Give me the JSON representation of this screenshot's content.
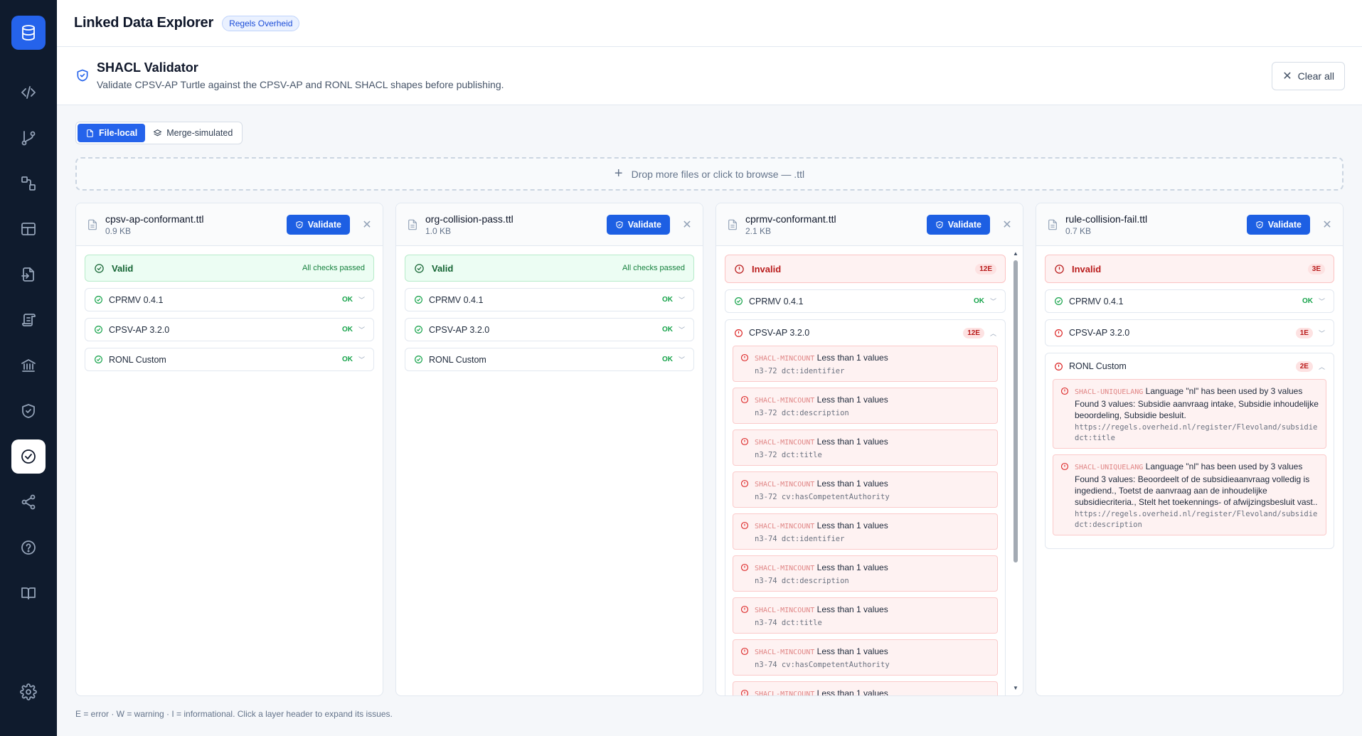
{
  "app": {
    "title": "Linked Data Explorer",
    "badge": "Regels Overheid"
  },
  "sidebar": {
    "items": [
      {
        "name": "database-icon"
      },
      {
        "name": "code-icon"
      },
      {
        "name": "git-branch-icon"
      },
      {
        "name": "shapes-icon"
      },
      {
        "name": "layout-icon"
      },
      {
        "name": "file-import-icon"
      },
      {
        "name": "scroll-icon"
      },
      {
        "name": "institution-icon"
      },
      {
        "name": "shield-check-icon"
      },
      {
        "name": "circle-check-icon",
        "active": true
      },
      {
        "name": "share-icon"
      },
      {
        "name": "help-circle-icon"
      },
      {
        "name": "book-icon"
      },
      {
        "name": "gear-icon"
      }
    ]
  },
  "page": {
    "title": "SHACL Validator",
    "description": "Validate CPSV-AP Turtle against the CPSV-AP and RONL SHACL shapes before publishing.",
    "clear_label": "Clear all"
  },
  "mode": {
    "options": [
      "File-local",
      "Merge-simulated"
    ],
    "selected": "File-local"
  },
  "dropzone": {
    "label": "Drop more files or click to browse — .ttl"
  },
  "validate_label": "Validate",
  "ok_label": "OK",
  "files": [
    {
      "name": "cpsv-ap-conformant.ttl",
      "size": "0.9 KB",
      "status": "Valid",
      "status_note": "All checks passed",
      "layers": [
        {
          "name": "CPRMV 0.4.1",
          "result": "OK"
        },
        {
          "name": "CPSV-AP 3.2.0",
          "result": "OK"
        },
        {
          "name": "RONL Custom",
          "result": "OK"
        }
      ]
    },
    {
      "name": "org-collision-pass.ttl",
      "size": "1.0 KB",
      "status": "Valid",
      "status_note": "All checks passed",
      "layers": [
        {
          "name": "CPRMV 0.4.1",
          "result": "OK"
        },
        {
          "name": "CPSV-AP 3.2.0",
          "result": "OK"
        },
        {
          "name": "RONL Custom",
          "result": "OK"
        }
      ]
    },
    {
      "name": "cprmv-conformant.ttl",
      "size": "2.1 KB",
      "status": "Invalid",
      "status_count": "12E",
      "layers": [
        {
          "name": "CPRMV 0.4.1",
          "result": "OK"
        },
        {
          "name": "CPSV-AP 3.2.0",
          "result": "12E",
          "expanded": true,
          "issues": [
            {
              "code": "SHACL-MINCOUNT",
              "message": "Less than 1 values",
              "path": "n3-72 dct:identifier"
            },
            {
              "code": "SHACL-MINCOUNT",
              "message": "Less than 1 values",
              "path": "n3-72 dct:description"
            },
            {
              "code": "SHACL-MINCOUNT",
              "message": "Less than 1 values",
              "path": "n3-72 dct:title"
            },
            {
              "code": "SHACL-MINCOUNT",
              "message": "Less than 1 values",
              "path": "n3-72 cv:hasCompetentAuthority"
            },
            {
              "code": "SHACL-MINCOUNT",
              "message": "Less than 1 values",
              "path": "n3-74 dct:identifier"
            },
            {
              "code": "SHACL-MINCOUNT",
              "message": "Less than 1 values",
              "path": "n3-74 dct:description"
            },
            {
              "code": "SHACL-MINCOUNT",
              "message": "Less than 1 values",
              "path": "n3-74 dct:title"
            },
            {
              "code": "SHACL-MINCOUNT",
              "message": "Less than 1 values",
              "path": "n3-74 cv:hasCompetentAuthority"
            },
            {
              "code": "SHACL-MINCOUNT",
              "message": "Less than 1 values",
              "path": ""
            }
          ]
        }
      ]
    },
    {
      "name": "rule-collision-fail.ttl",
      "size": "0.7 KB",
      "status": "Invalid",
      "status_count": "3E",
      "layers": [
        {
          "name": "CPRMV 0.4.1",
          "result": "OK"
        },
        {
          "name": "CPSV-AP 3.2.0",
          "result": "1E"
        },
        {
          "name": "RONL Custom",
          "result": "2E",
          "expanded": true,
          "issues": [
            {
              "code": "SHACL-UNIQUELANG",
              "message": "Language \"nl\" has been used by 3 values Found 3 values: Subsidie aanvraag intake, Subsidie inhoudelijke beoordeling, Subsidie besluit.",
              "path": "https://regels.overheid.nl/register/Flevoland/subsidie dct:title"
            },
            {
              "code": "SHACL-UNIQUELANG",
              "message": "Language \"nl\" has been used by 3 values Found 3 values: Beoordeelt of de subsidieaanvraag volledig is ingediend., Toetst de aanvraag aan de inhoudelijke subsidiecriteria., Stelt het toekennings- of afwijzingsbesluit vast..",
              "path": "https://regels.overheid.nl/register/Flevoland/subsidie dct:description"
            }
          ]
        }
      ]
    }
  ],
  "footnote": "E = error · W = warning · I = informational. Click a layer header to expand its issues."
}
